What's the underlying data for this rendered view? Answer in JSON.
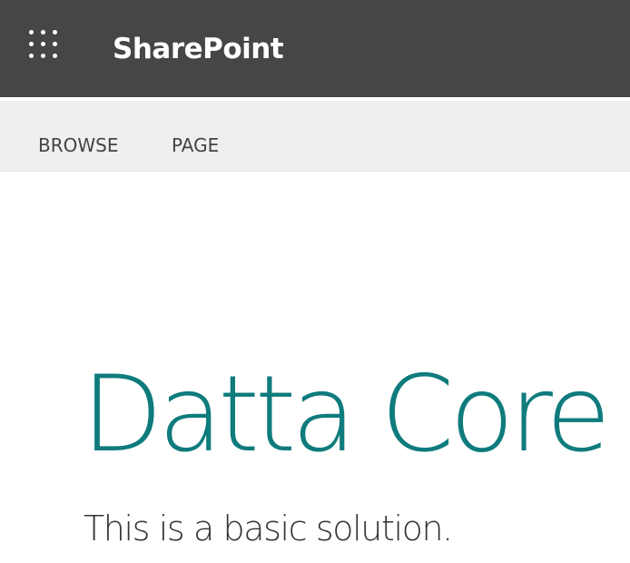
{
  "suite_bar": {
    "app_launcher_icon": "waffle-grid-icon",
    "brand": "SharePoint",
    "background_color": "#484644"
  },
  "ribbon": {
    "tabs": [
      {
        "label": "BROWSE"
      },
      {
        "label": "PAGE"
      }
    ],
    "background_color": "#efefef"
  },
  "page": {
    "site_title": "Datta Core",
    "site_description": "This is a basic solution.",
    "title_color": "#0f7b7d"
  }
}
